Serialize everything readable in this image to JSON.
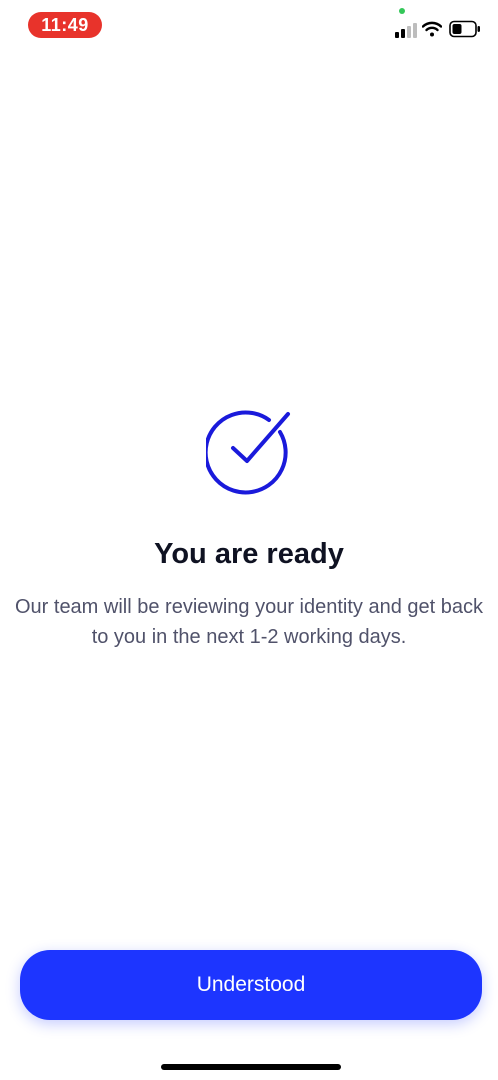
{
  "status_bar": {
    "time": "11:49",
    "time_pill_color": "#e8332b",
    "privacy_dot_color": "#34c759",
    "signal_icon": "cellular-signal-icon",
    "wifi_icon": "wifi-icon",
    "battery_icon": "battery-icon"
  },
  "content": {
    "icon": "check-circle-icon",
    "icon_color": "#1a1adb",
    "title": "You are ready",
    "message": "Our team will be reviewing your identity and get back to you in the next 1-2 working days."
  },
  "actions": {
    "primary_label": "Understood",
    "primary_color": "#1d35ff"
  }
}
